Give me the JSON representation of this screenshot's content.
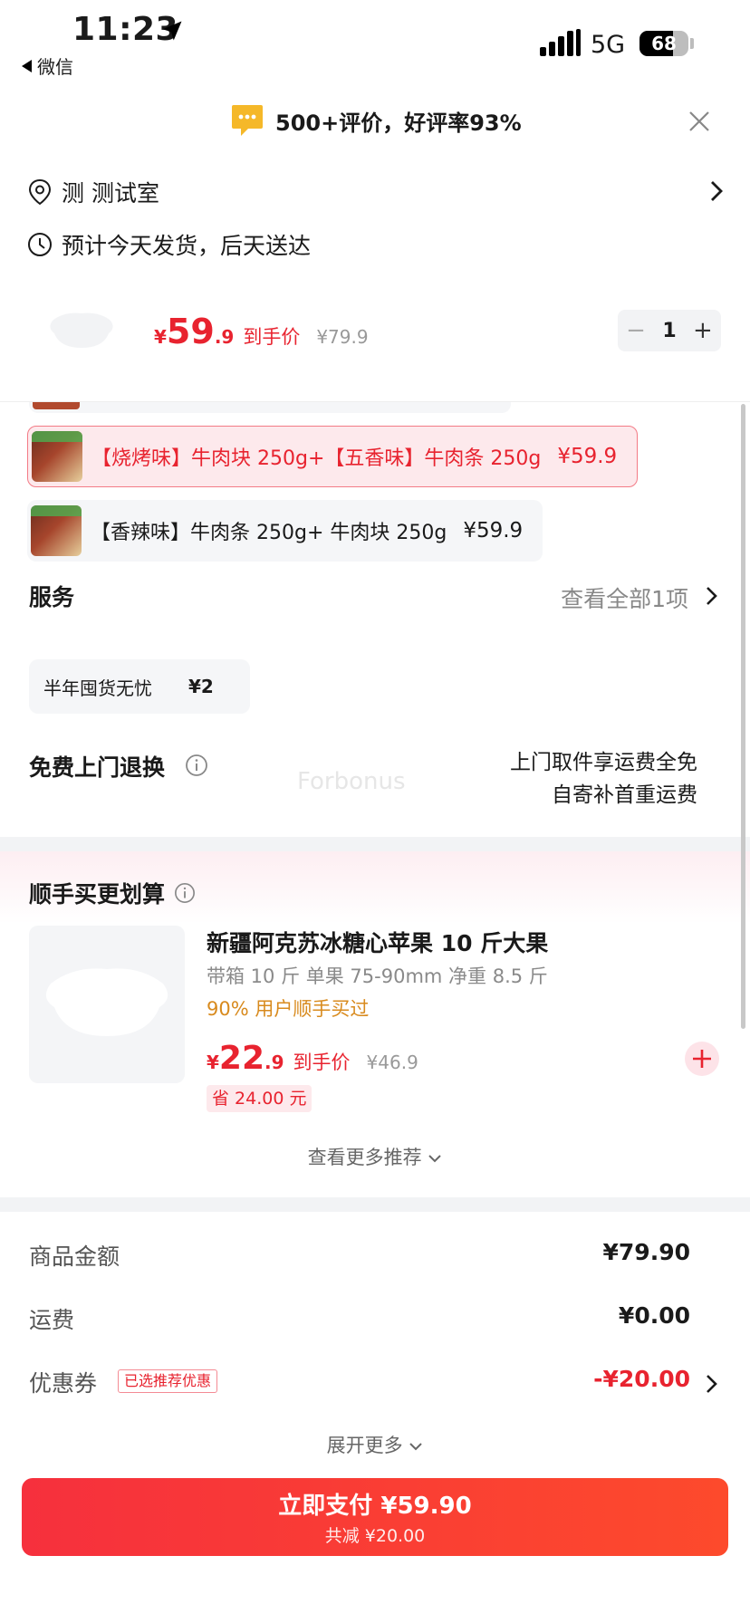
{
  "status_bar": {
    "time": "11:23",
    "back_app": "微信",
    "network": "5G",
    "battery": "68",
    "battery_level": 0.68
  },
  "rating_banner": {
    "text": "500+评价，好评率93%"
  },
  "address": {
    "text": "测  测试室"
  },
  "delivery": {
    "text": "预计今天发货，后天送达"
  },
  "price": {
    "currency": "¥",
    "integer": "59",
    "decimal": ".9",
    "tag": "到手价",
    "original": "¥79.9",
    "quantity": "1",
    "minus": "−",
    "plus": "+"
  },
  "sku_options": [
    {
      "label": "【烧烤味】牛肉块 250g+【五香味】牛肉条 250g",
      "price": "¥59.9",
      "selected": true
    },
    {
      "label": "【香辣味】牛肉条 250g+ 牛肉块 250g",
      "price": "¥59.9",
      "selected": false
    }
  ],
  "service": {
    "title": "服务",
    "view_all": "查看全部1项",
    "chip_name": "半年囤货无忧",
    "chip_price": "¥2"
  },
  "free_return": {
    "title": "免费上门退换",
    "line1": "上门取件享运费全免",
    "line2": "自寄补首重运费"
  },
  "watermark": "Forbonus",
  "recommend": {
    "title": "顺手买更划算",
    "name": "新疆阿克苏冰糖心苹果 10 斤大果",
    "spec": "带箱 10 斤 单果 75-90mm 净重 8.5 斤",
    "social": "90% 用户顺手买过",
    "currency": "¥",
    "integer": "22",
    "decimal": ".9",
    "tag": "到手价",
    "original": "¥46.9",
    "save": "省 24.00 元",
    "more": "查看更多推荐"
  },
  "summary": {
    "goods_label": "商品金额",
    "goods_value": "¥79.90",
    "shipping_label": "运费",
    "shipping_value": "¥0.00",
    "coupon_label": "优惠券",
    "coupon_badge": "已选推荐优惠",
    "coupon_value": "-¥20.00",
    "expand": "展开更多"
  },
  "pay_button": {
    "main": "立即支付 ¥59.90",
    "sub": "共减 ¥20.00"
  },
  "colors": {
    "accent_red": "#e8232f",
    "social_orange": "#d88a1d",
    "banner_icon": "#f5b829"
  }
}
